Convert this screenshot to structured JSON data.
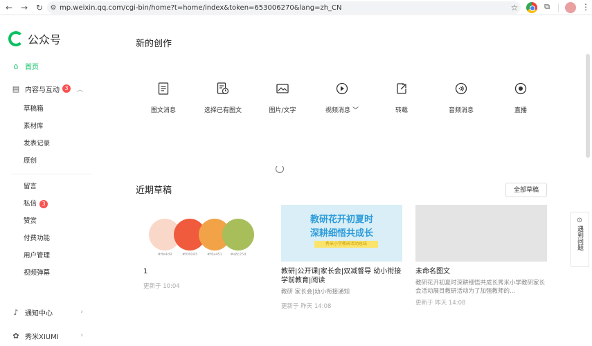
{
  "browser": {
    "url": "mp.weixin.qq.com/cgi-bin/home?t=home/index&token=653006270&lang=zh_CN"
  },
  "sidebar": {
    "logo_text": "公众号",
    "home": "首页",
    "content_group": "内容与互动",
    "content_badge": "3",
    "content_items": [
      "草稿箱",
      "素材库",
      "发表记录",
      "原创"
    ],
    "interaction_items": [
      "留言",
      "私信",
      "赞赏",
      "付费功能",
      "用户管理",
      "视频弹幕"
    ],
    "inbox_badge": "3",
    "notice_center": "通知中心",
    "xiumi": "秀米XIUMI"
  },
  "main": {
    "create_title": "新的创作",
    "create_items": [
      {
        "label": "图文消息",
        "icon": "document-icon"
      },
      {
        "label": "选择已有图文",
        "icon": "document-clock-icon"
      },
      {
        "label": "图片/文字",
        "icon": "image-icon"
      },
      {
        "label": "视频消息",
        "icon": "play-icon"
      },
      {
        "label": "转载",
        "icon": "share-icon"
      },
      {
        "label": "音频消息",
        "icon": "audio-icon"
      },
      {
        "label": "直播",
        "icon": "live-icon"
      }
    ],
    "drafts_title": "近期草稿",
    "all_drafts_button": "全部草稿",
    "drafts": [
      {
        "title": "1",
        "subtitle": "",
        "time": "更新于 10:04",
        "swatches": [
          {
            "color": "#f9d8c9",
            "label": "#ffe4d9"
          },
          {
            "color": "#ef5b3c",
            "label": "#f06043"
          },
          {
            "color": "#f2a348",
            "label": "#f6a451"
          },
          {
            "color": "#a7be5a",
            "label": "#a8c25d"
          }
        ]
      },
      {
        "title": "教研|公开课|家长会|双减督导 幼小衔接 学前教育|阅读",
        "subtitle": "教研 家长会|幼小衔接通知",
        "time": "更新于 昨天 14:08",
        "cover_line1": "教研花开初夏时",
        "cover_line2": "深耕细悟共成长",
        "cover_small": "秀米小学教研活动总结"
      },
      {
        "title": "未命名图文",
        "subtitle": "教研花开初夏时深耕细悟共成长秀米小学教研家长会活动展目教研活动为了加强教师的...",
        "time": "更新于 昨天 14:08"
      }
    ]
  },
  "help": {
    "label": "遇到问题"
  }
}
